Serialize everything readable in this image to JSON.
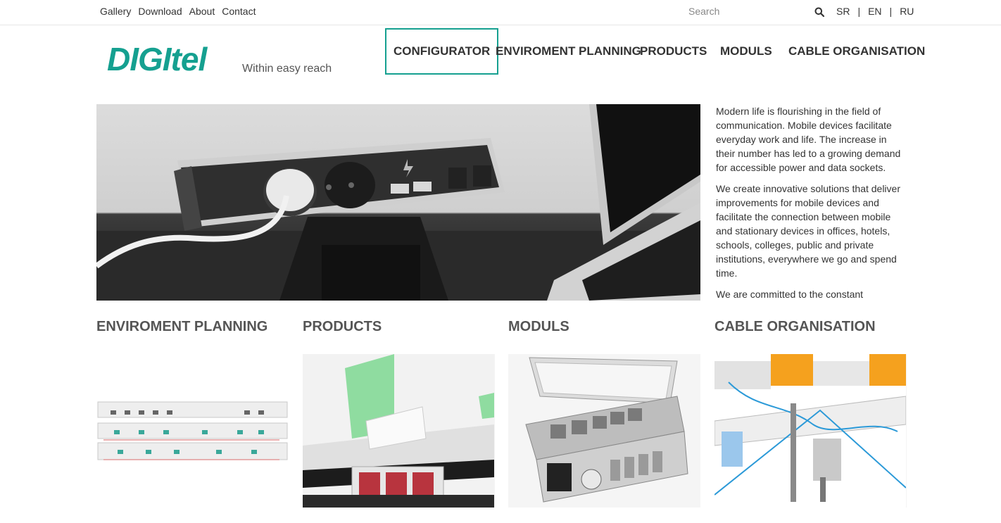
{
  "topbar": {
    "links": [
      "Gallery",
      "Download",
      "About",
      "Contact"
    ],
    "search_placeholder": "Search",
    "search_icon": "search-icon",
    "languages": [
      "SR",
      "EN",
      "RU"
    ],
    "language_separator": "|"
  },
  "brand": {
    "logo_text": "DIGItel",
    "tagline": "Within easy reach",
    "accent_color": "#15a090"
  },
  "nav": {
    "items": [
      "CONFIGURATOR",
      "ENVIROMENT PLANNING",
      "PRODUCTS",
      "MODULS",
      "CABLE ORGANISATION"
    ],
    "active": "CONFIGURATOR"
  },
  "intro": {
    "paragraphs": [
      "Modern life is flourishing in the field of communication. Mobile devices facilitate everyday work and life. The increase in their number has led to a growing demand for accessible power and data sockets.",
      "We create innovative solutions that deliver improvements for mobile devices and facilitate the connection between mobile and stationary devices in offices, hotels, schools, colleges, public and private institutions, everywhere we go and spend time.",
      "We are committed to the constant"
    ]
  },
  "categories": [
    {
      "title": "ENVIROMENT PLANNING"
    },
    {
      "title": "PRODUCTS"
    },
    {
      "title": "MODULS"
    },
    {
      "title": "CABLE ORGANISATION"
    }
  ]
}
